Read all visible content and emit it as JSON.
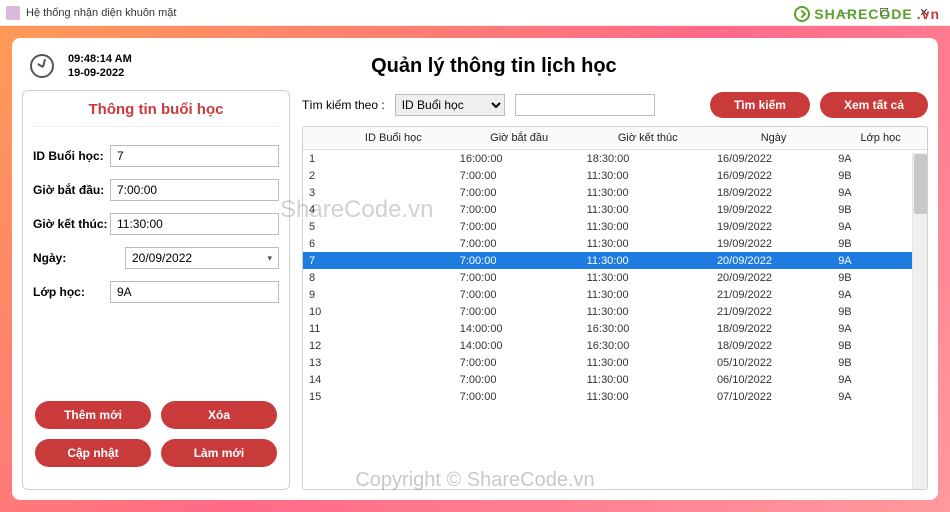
{
  "window": {
    "title": "Hệ thống nhận diện khuôn mặt",
    "min": "—",
    "max": "☐",
    "close": "✕"
  },
  "logo": {
    "text": "SHARECODE",
    "suffix": ".vn"
  },
  "clock": {
    "time": "09:48:14 AM",
    "date": "19-09-2022"
  },
  "page_title": "Quản lý thông tin lịch học",
  "left": {
    "title": "Thông tin buổi học",
    "fields": {
      "id_label": "ID Buổi học:",
      "id_value": "7",
      "start_label": "Giờ bắt đầu:",
      "start_value": "7:00:00",
      "end_label": "Giờ kết thúc:",
      "end_value": "11:30:00",
      "date_label": "Ngày:",
      "date_value": "20/09/2022",
      "class_label": "Lớp học:",
      "class_value": "9A"
    },
    "buttons": {
      "add": "Thêm mới",
      "del": "Xóa",
      "upd": "Cập nhật",
      "ref": "Làm mới"
    }
  },
  "search": {
    "label": "Tìm kiếm theo  :",
    "by": "ID Buổi học",
    "term": "",
    "btn_search": "Tìm kiếm",
    "btn_all": "Xem tất cả"
  },
  "table": {
    "cols": [
      "ID Buổi học",
      "Giờ bắt đầu",
      "Giờ kết thúc",
      "Ngày",
      "Lớp học"
    ],
    "selected_index": 6,
    "rows": [
      [
        "1",
        "16:00:00",
        "18:30:00",
        "16/09/2022",
        "9A"
      ],
      [
        "2",
        "7:00:00",
        "11:30:00",
        "16/09/2022",
        "9B"
      ],
      [
        "3",
        "7:00:00",
        "11:30:00",
        "18/09/2022",
        "9A"
      ],
      [
        "4",
        "7:00:00",
        "11:30:00",
        "19/09/2022",
        "9B"
      ],
      [
        "5",
        "7:00:00",
        "11:30:00",
        "19/09/2022",
        "9A"
      ],
      [
        "6",
        "7:00:00",
        "11:30:00",
        "19/09/2022",
        "9B"
      ],
      [
        "7",
        "7:00:00",
        "11:30:00",
        "20/09/2022",
        "9A"
      ],
      [
        "8",
        "7:00:00",
        "11:30:00",
        "20/09/2022",
        "9B"
      ],
      [
        "9",
        "7:00:00",
        "11:30:00",
        "21/09/2022",
        "9A"
      ],
      [
        "10",
        "7:00:00",
        "11:30:00",
        "21/09/2022",
        "9B"
      ],
      [
        "11",
        "14:00:00",
        "16:30:00",
        "18/09/2022",
        "9A"
      ],
      [
        "12",
        "14:00:00",
        "16:30:00",
        "18/09/2022",
        "9B"
      ],
      [
        "13",
        "7:00:00",
        "11:30:00",
        "05/10/2022",
        "9B"
      ],
      [
        "14",
        "7:00:00",
        "11:30:00",
        "06/10/2022",
        "9A"
      ],
      [
        "15",
        "7:00:00",
        "11:30:00",
        "07/10/2022",
        "9A"
      ]
    ]
  },
  "watermark": {
    "w1": "ShareCode.vn",
    "w2": "Copyright © ShareCode.vn"
  }
}
